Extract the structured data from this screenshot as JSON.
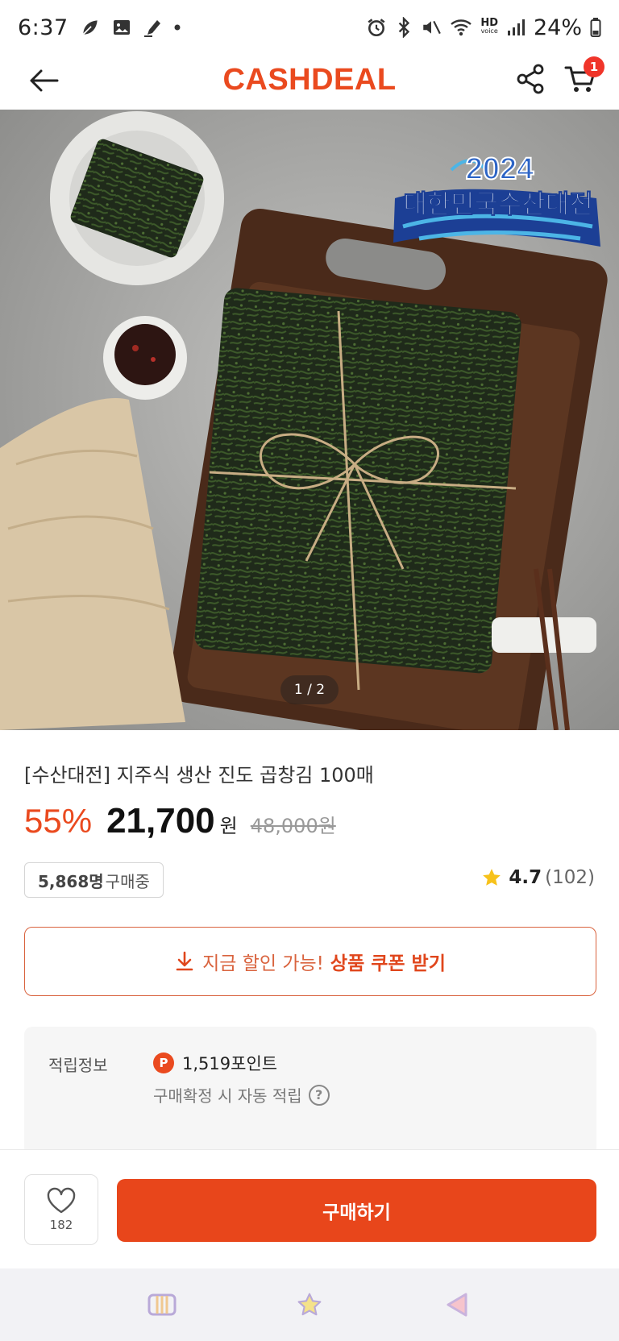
{
  "status_bar": {
    "time": "6:37",
    "battery": "24%",
    "hd_label": "HD",
    "voice_label": "voice"
  },
  "header": {
    "brand": "CASHDEAL",
    "cart_count": "1"
  },
  "gallery": {
    "pager": "1 / 2",
    "event_badge_year": "2024",
    "event_badge_title": "대한민국수산대전"
  },
  "product": {
    "title": "[수산대전] 지주식 생산 진도 곱창김 100매",
    "discount": "55%",
    "price": "21,700",
    "currency": "원",
    "original_price": "48,000원",
    "buyers_count": "5,868명",
    "buyers_suffix": " 구매중",
    "rating": "4.7",
    "review_count": "(102)"
  },
  "coupon": {
    "prefix": "지금 할인 가능!",
    "action": "상품 쿠폰 받기"
  },
  "points": {
    "label": "적립정보",
    "icon_letter": "P",
    "value": "1,519포인트",
    "note": "구매확정 시 자동 적립",
    "help_glyph": "?"
  },
  "actions": {
    "like_count": "182",
    "buy_label": "구매하기"
  },
  "colors": {
    "brand": "#ea4a1f",
    "buy_button": "#e8461b",
    "badge": "#f0352a"
  }
}
